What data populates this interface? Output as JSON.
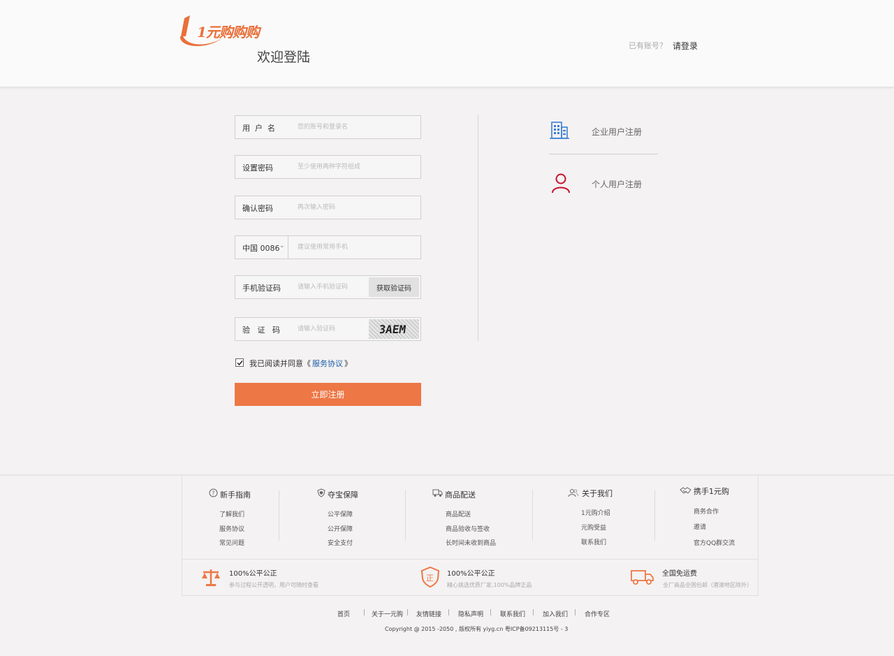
{
  "header": {
    "logo_text": "1元购购购",
    "welcome": "欢迎登陆",
    "have_account": "已有账号？",
    "login_link": "请登录"
  },
  "form": {
    "username": {
      "label": "用  户  名",
      "placeholder": "您的账号和登录名"
    },
    "password": {
      "label": "设置密码",
      "placeholder": "至少使用两种字符组成"
    },
    "confirm": {
      "label": "确认密码",
      "placeholder": "再次输入密码"
    },
    "phone": {
      "country_code": "中国 0086",
      "placeholder": "建议使用常用手机"
    },
    "sms": {
      "label": "手机验证码",
      "placeholder": "请输入手机验证码",
      "button": "获取验证码"
    },
    "captcha": {
      "label": "验   证   码",
      "placeholder": "请输入验证码",
      "image_text": "3AEM"
    },
    "agree": {
      "checked": true,
      "text": "我已阅读并同意《",
      "link": "服务协议",
      "close": "》"
    },
    "submit": "立即注册"
  },
  "register_options": {
    "enterprise": {
      "label": "企业用户注册",
      "icon": "building-icon",
      "color": "#3c7fd6"
    },
    "personal": {
      "label": "个人用户注册",
      "icon": "user-icon",
      "color": "#c8102e"
    }
  },
  "footer": {
    "columns": [
      {
        "title": "新手指南",
        "icon": "question-circle-icon",
        "links": [
          "了解我们",
          "服务协议",
          "常见问题"
        ]
      },
      {
        "title": "夺宝保障",
        "icon": "shield-icon",
        "links": [
          "公平保障",
          "公开保障",
          "安全支付"
        ]
      },
      {
        "title": "商品配送",
        "icon": "truck-icon",
        "links": [
          "商品配送",
          "商品验收与签收",
          "长时间未收到商品"
        ]
      },
      {
        "title": "关于我们",
        "icon": "users-icon",
        "links": [
          "1元购介绍",
          "元购受益",
          "联系我们"
        ]
      },
      {
        "title": "携手1元购",
        "icon": "handshake-icon",
        "links": [
          "商务合作",
          "邀请",
          "官方QQ群交流"
        ]
      }
    ],
    "features": [
      {
        "title": "100%公平公正",
        "desc": "参与过程公开透明，用户可随时查看",
        "icon": "scale-icon"
      },
      {
        "title": "100%公平公正",
        "desc": "精心挑选优质厂家,100%品牌正品",
        "icon": "genuine-badge-icon",
        "badge_char": "正"
      },
      {
        "title": "全国免运费",
        "desc": "全厂商品全国包邮（港澳地区除外）",
        "icon": "delivery-truck-icon"
      }
    ],
    "nav": [
      "首页",
      "关于一元购",
      "友情链接",
      "隐私声明",
      "联系我们",
      "加入我们",
      "合作专区"
    ],
    "copyright": "Copyright @ 2015 -2050 , 版权所有 yiyg.cn 粤ICP备09213115号 - 3"
  },
  "colors": {
    "accent": "#ed7745",
    "brand": "#e9703a",
    "link": "#1e5ea8",
    "background": "#f4f2f2"
  }
}
